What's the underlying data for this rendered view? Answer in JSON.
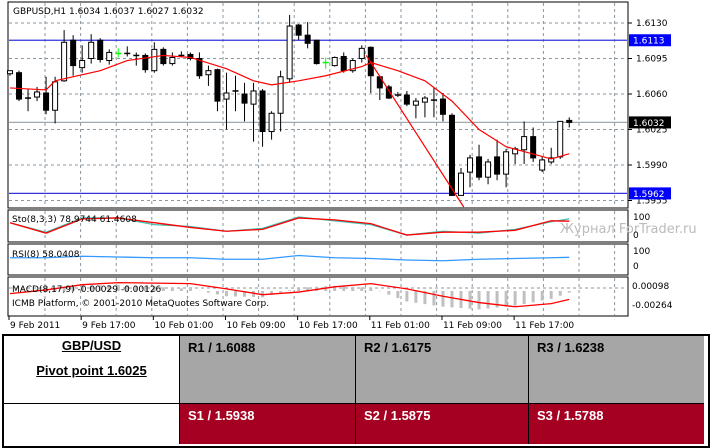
{
  "chart": {
    "title": "GBPUSD,H1  1.6034 1.6037 1.6027 1.6032",
    "price_ticks": [
      "1.6130",
      "1.6095",
      "1.6060",
      "1.6025",
      "1.5990",
      "1.5955"
    ],
    "levels": [
      {
        "label": "1.6113",
        "price": 1.6113,
        "color": "#3333dd",
        "bg": "#0000ff"
      },
      {
        "label": "1.5962",
        "price": 1.5962,
        "color": "#3333dd",
        "bg": "#0000ff"
      },
      {
        "label": "1.6032",
        "price": 1.6032,
        "color": "#a0a8b0",
        "bg": "#000000"
      }
    ],
    "time_labels": [
      {
        "label": "9 Feb 2011",
        "bar": 0
      },
      {
        "label": "9 Feb 17:00",
        "bar": 8
      },
      {
        "label": "10 Feb 01:00",
        "bar": 16
      },
      {
        "label": "10 Feb 09:00",
        "bar": 24
      },
      {
        "label": "10 Feb 17:00",
        "bar": 32
      },
      {
        "label": "11 Feb 01:00",
        "bar": 40
      },
      {
        "label": "11 Feb 09:00",
        "bar": 48
      },
      {
        "label": "11 Feb 17:00",
        "bar": 56
      }
    ],
    "green_bars": [
      12,
      35
    ],
    "candles": [
      [
        1.608,
        1.6083,
        1.6078,
        1.6083
      ],
      [
        1.6081,
        1.6083,
        1.6053,
        1.6055
      ],
      [
        1.6056,
        1.6065,
        1.6043,
        1.6056
      ],
      [
        1.6057,
        1.6067,
        1.6053,
        1.6062
      ],
      [
        1.6061,
        1.6077,
        1.604,
        1.6044
      ],
      [
        1.6044,
        1.6077,
        1.6031,
        1.6072
      ],
      [
        1.6073,
        1.6123,
        1.6072,
        1.6111
      ],
      [
        1.6113,
        1.6118,
        1.6078,
        1.6088
      ],
      [
        1.6086,
        1.6108,
        1.6081,
        1.6093
      ],
      [
        1.6095,
        1.6119,
        1.609,
        1.6111
      ],
      [
        1.6113,
        1.6115,
        1.6091,
        1.6094
      ],
      [
        1.6093,
        1.6104,
        1.6089,
        1.6101
      ],
      [
        1.61,
        1.6105,
        1.6096,
        1.61
      ],
      [
        1.61,
        1.6107,
        1.6097,
        1.61
      ],
      [
        1.6098,
        1.6101,
        1.6088,
        1.6098
      ],
      [
        1.6098,
        1.61,
        1.6081,
        1.6084
      ],
      [
        1.6083,
        1.6111,
        1.6081,
        1.6104
      ],
      [
        1.6104,
        1.6106,
        1.6088,
        1.609
      ],
      [
        1.609,
        1.6101,
        1.6088,
        1.6096
      ],
      [
        1.6098,
        1.6102,
        1.6096,
        1.6098
      ],
      [
        1.6099,
        1.6101,
        1.6093,
        1.6095
      ],
      [
        1.6095,
        1.6101,
        1.6075,
        1.6078
      ],
      [
        1.6079,
        1.6088,
        1.6068,
        1.6083
      ],
      [
        1.6084,
        1.6085,
        1.6043,
        1.6053
      ],
      [
        1.6055,
        1.6081,
        1.6025,
        1.6061
      ],
      [
        1.6063,
        1.6078,
        1.6043,
        1.6063
      ],
      [
        1.606,
        1.6071,
        1.6033,
        1.6051
      ],
      [
        1.605,
        1.6071,
        1.6013,
        1.6063
      ],
      [
        1.6063,
        1.6065,
        1.6008,
        1.6023
      ],
      [
        1.6023,
        1.6043,
        1.6015,
        1.6041
      ],
      [
        1.6041,
        1.6083,
        1.6023,
        1.6077
      ],
      [
        1.6075,
        1.6138,
        1.6071,
        1.6127
      ],
      [
        1.6128,
        1.6129,
        1.6113,
        1.6118
      ],
      [
        1.6118,
        1.6131,
        1.6105,
        1.611
      ],
      [
        1.6113,
        1.6113,
        1.6089,
        1.609
      ],
      [
        1.6091,
        1.6096,
        1.6085,
        1.6091
      ],
      [
        1.6088,
        1.6097,
        1.6087,
        1.6096
      ],
      [
        1.6097,
        1.6101,
        1.6081,
        1.6083
      ],
      [
        1.6083,
        1.6095,
        1.6081,
        1.6093
      ],
      [
        1.6095,
        1.6108,
        1.6091,
        1.6105
      ],
      [
        1.6106,
        1.6107,
        1.6061,
        1.6078
      ],
      [
        1.6077,
        1.6078,
        1.6054,
        1.6066
      ],
      [
        1.6067,
        1.6069,
        1.6055,
        1.6056
      ],
      [
        1.6059,
        1.6062,
        1.6057,
        1.6059
      ],
      [
        1.6059,
        1.6063,
        1.6048,
        1.605
      ],
      [
        1.6049,
        1.6056,
        1.6036,
        1.6053
      ],
      [
        1.6052,
        1.6058,
        1.6037,
        1.6056
      ],
      [
        1.6054,
        1.6067,
        1.6037,
        1.6054
      ],
      [
        1.6055,
        1.6061,
        1.6033,
        1.604
      ],
      [
        1.6039,
        1.6041,
        1.596,
        1.596
      ],
      [
        1.596,
        1.5987,
        1.596,
        1.5982
      ],
      [
        1.5983,
        1.6,
        1.5968,
        1.5997
      ],
      [
        1.5998,
        1.601,
        1.5975,
        1.5978
      ],
      [
        1.5978,
        1.5996,
        1.5971,
        1.5993
      ],
      [
        1.5998,
        1.6015,
        1.5975,
        1.5981
      ],
      [
        1.5981,
        1.6006,
        1.5968,
        1.6003
      ],
      [
        1.6001,
        1.6008,
        1.5991,
        1.6006
      ],
      [
        1.6005,
        1.6033,
        1.5991,
        1.6018
      ],
      [
        1.6018,
        1.6027,
        1.5993,
        1.5997
      ],
      [
        1.5985,
        1.5998,
        1.5983,
        1.5995
      ],
      [
        1.5993,
        1.6007,
        1.5991,
        1.5997
      ],
      [
        1.5998,
        1.6033,
        1.5996,
        1.6033
      ],
      [
        1.6034,
        1.6037,
        1.6027,
        1.6032
      ]
    ],
    "ma": [
      [
        0,
        1.6066
      ],
      [
        4,
        1.6064
      ],
      [
        5,
        1.6073
      ],
      [
        10,
        1.6083
      ],
      [
        13,
        1.6093
      ],
      [
        17,
        1.6098
      ],
      [
        20,
        1.6096
      ],
      [
        24,
        1.6085
      ],
      [
        27,
        1.6073
      ],
      [
        29,
        1.6069
      ],
      [
        32,
        1.6073
      ],
      [
        35,
        1.6078
      ],
      [
        39,
        1.6087
      ],
      [
        40,
        1.6091
      ],
      [
        43,
        1.6083
      ],
      [
        46,
        1.6073
      ],
      [
        49,
        1.6053
      ],
      [
        52,
        1.6025
      ],
      [
        55,
        1.6008
      ],
      [
        60,
        1.5996
      ],
      [
        62,
        1.6001
      ]
    ],
    "trendline": {
      "from": [
        39.5,
        1.6098
      ],
      "to": [
        50.3,
        1.5945
      ],
      "color": "#ff0000"
    },
    "ma_color": "#ff0000",
    "watermark": "Журнал ForTrader.ru"
  },
  "indicators": {
    "sample_bars": [
      0,
      4,
      8,
      12,
      16,
      20,
      24,
      28,
      32,
      36,
      40,
      44,
      48,
      52,
      56,
      60,
      62
    ],
    "sto": {
      "label": "Sto(8,3,3) 78.9744 61.4608",
      "ticks": [
        "100",
        "0"
      ],
      "main": [
        70,
        20,
        95,
        95,
        60,
        50,
        25,
        40,
        100,
        80,
        60,
        5,
        25,
        15,
        35,
        75,
        90
      ],
      "signal": [
        70,
        15,
        90,
        95,
        70,
        45,
        25,
        35,
        95,
        85,
        65,
        5,
        20,
        20,
        30,
        80,
        78
      ],
      "main_color": "#40c0b0",
      "signal_color": "#ff0000"
    },
    "rsi": {
      "label": "RSI(8) 58.0408",
      "ticks": [
        "100",
        "0"
      ],
      "values": [
        55,
        55,
        65,
        60,
        55,
        55,
        45,
        45,
        70,
        55,
        50,
        40,
        35,
        45,
        50,
        55,
        58
      ],
      "color": "#3399ff"
    },
    "macd": {
      "label": "MACD(8,17,9) -0.00029 -0.00126",
      "copyright": "ICMB Platform, © 2001-2010 MetaQuotes Software Corp.",
      "ticks": [
        "0.00098",
        "-0.00264"
      ],
      "hist": [
        0.0001,
        0.0004,
        0.001,
        0.0012,
        0.0008,
        0.0004,
        -0.001,
        -0.0012,
        0.0006,
        0.001,
        0.0006,
        -0.002,
        -0.003,
        -0.0035,
        -0.0028,
        -0.0015,
        -0.0003
      ],
      "signal": [
        -0.0005,
        0.0002,
        0.0012,
        0.0016,
        0.0015,
        0.0014,
        0.0004,
        -0.0007,
        -0.0002,
        0.0008,
        0.0014,
        0.0004,
        -0.001,
        -0.0022,
        -0.003,
        -0.0024,
        -0.0016
      ],
      "hist_color": "#c0c0c0",
      "signal_color": "#ff0000"
    }
  },
  "pivot_table": {
    "pair": "GBP/USD",
    "pivot": "Pivot point 1.6025",
    "resistance": [
      "R1 / 1.6088",
      "R2 / 1.6175",
      "R3 / 1.6238"
    ],
    "support": [
      "S1 / 1.5938",
      "S2 / 1.5875",
      "S3 / 1.5788"
    ],
    "resistance_color": "#a6a6a6",
    "support_color": "#a50021"
  }
}
